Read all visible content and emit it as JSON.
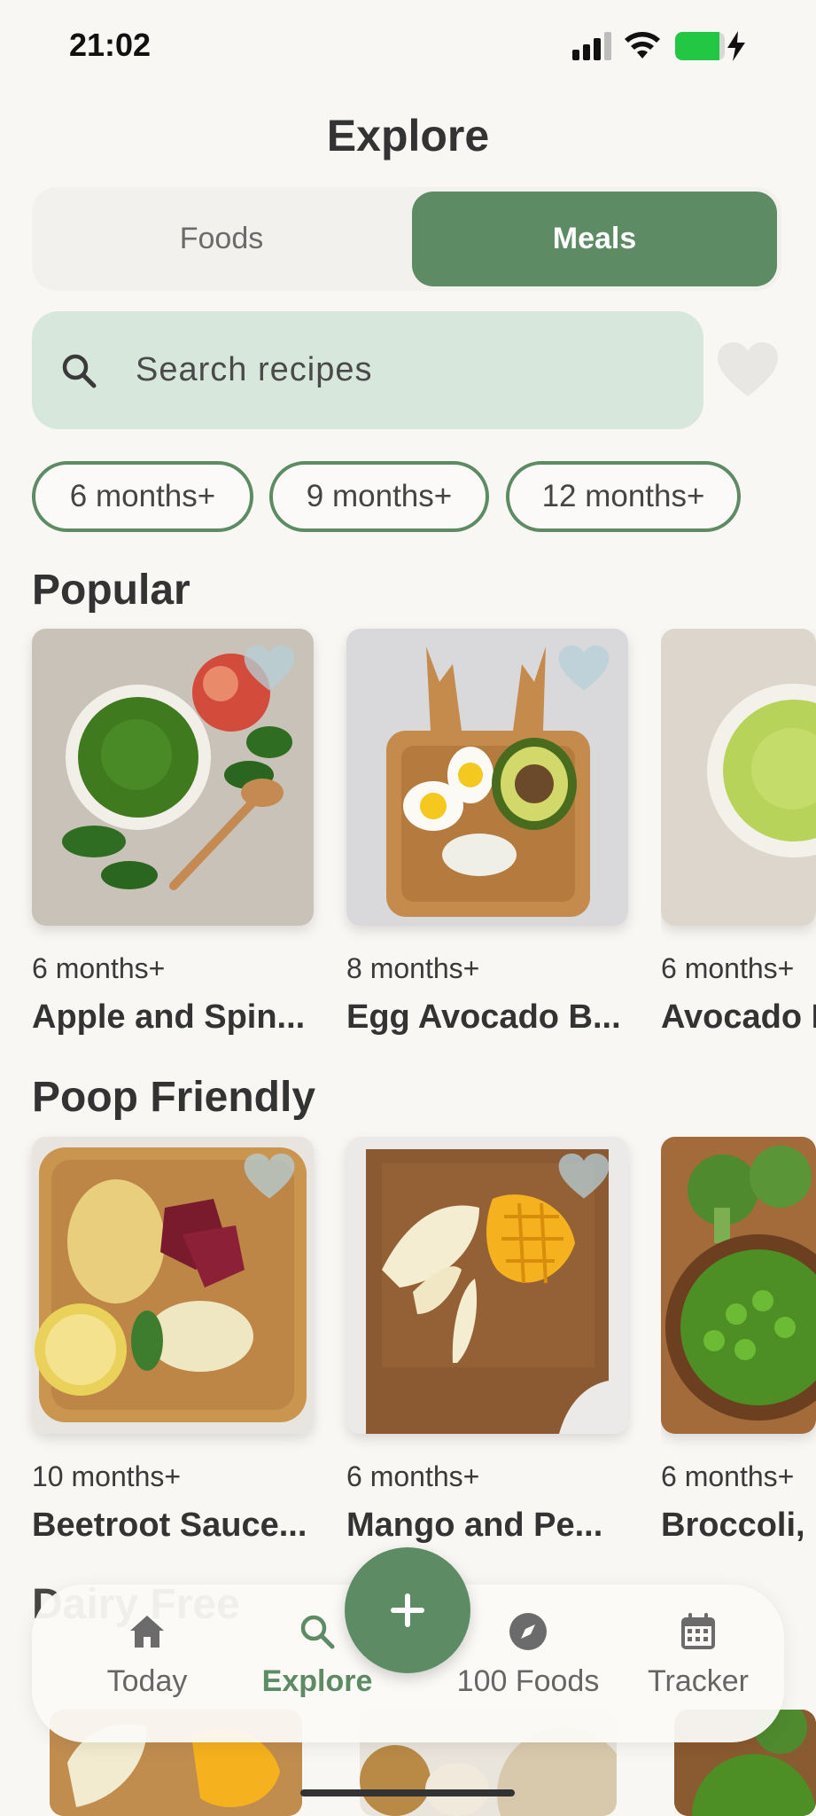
{
  "status_bar": {
    "time": "21:02"
  },
  "header": {
    "title": "Explore"
  },
  "segmented": {
    "foods": "Foods",
    "meals": "Meals",
    "active": "Meals"
  },
  "search": {
    "placeholder": "Search recipes"
  },
  "chips": [
    "6 months+",
    "9 months+",
    "12 months+"
  ],
  "sections": {
    "popular": {
      "title": "Popular",
      "cards": [
        {
          "age": "6 months+",
          "name": "Apple and Spin..."
        },
        {
          "age": "8 months+",
          "name": "Egg Avocado B..."
        },
        {
          "age": "6 months+",
          "name": "Avocado I"
        }
      ]
    },
    "poop_friendly": {
      "title": "Poop Friendly",
      "cards": [
        {
          "age": "10 months+",
          "name": "Beetroot Sauce..."
        },
        {
          "age": "6 months+",
          "name": "Mango and Pe..."
        },
        {
          "age": "6 months+",
          "name": "Broccoli, I"
        }
      ]
    },
    "dairy_free": {
      "title": "Dairy Free"
    }
  },
  "bottom_nav": {
    "today": "Today",
    "explore": "Explore",
    "hundred_foods": "100 Foods",
    "tracker": "Tracker",
    "active": "Explore"
  },
  "colors": {
    "accent": "#5d8b64",
    "search_bg": "#d8e7dc",
    "background": "#f9f7f4"
  }
}
